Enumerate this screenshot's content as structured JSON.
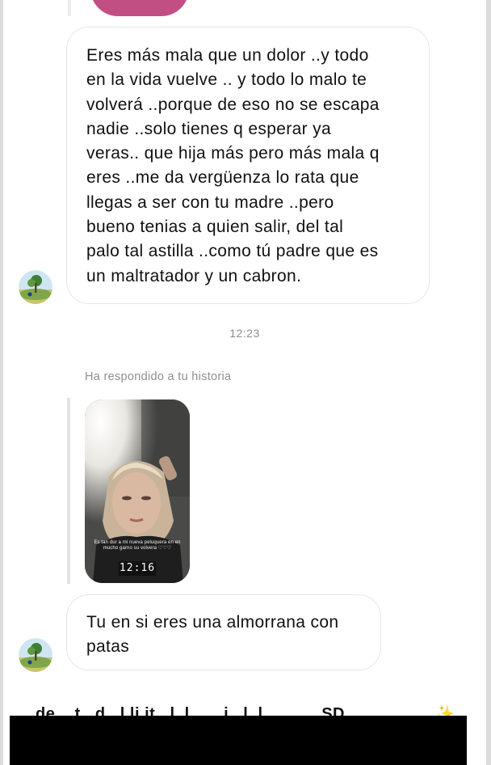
{
  "messages": {
    "first": {
      "lines": [
        "Eres más mala que un dolor ..y todo",
        "en la vida vuelve .. y todo lo malo te",
        "volverá ..porque de eso no se escapa",
        "nadie ..solo tienes q esperar ya",
        "veras.. que hija más pero más mala q",
        "eres ..me da vergüenza lo rata que",
        "llegas a ser con tu madre ..pero",
        "bueno tenias  a quien salir, del tal",
        "palo tal astilla ..como tú padre que es",
        "un maltratador y un cabron."
      ]
    },
    "timestamp": "12:23",
    "story_reply": {
      "label": "Ha respondido a tu historia",
      "story_time": "12:16",
      "caption": "Es tan dur a mi nueva peluquera en en mucho garno su volvera ♡♡♡"
    },
    "second": {
      "lines": [
        "Tu en si eres una almorrana con",
        "patas"
      ]
    }
  },
  "footer": {
    "partial_text": "de ...t...d...l.li.it...l..l.......i...l..l........ ...SD",
    "sparkle": "✨"
  },
  "colors": {
    "accent_pink": "#c24f83",
    "meta_text": "#8e8e8e",
    "bubble_border": "#e6e6e6"
  },
  "icons": {
    "avatar": "profile-avatar-icon"
  }
}
